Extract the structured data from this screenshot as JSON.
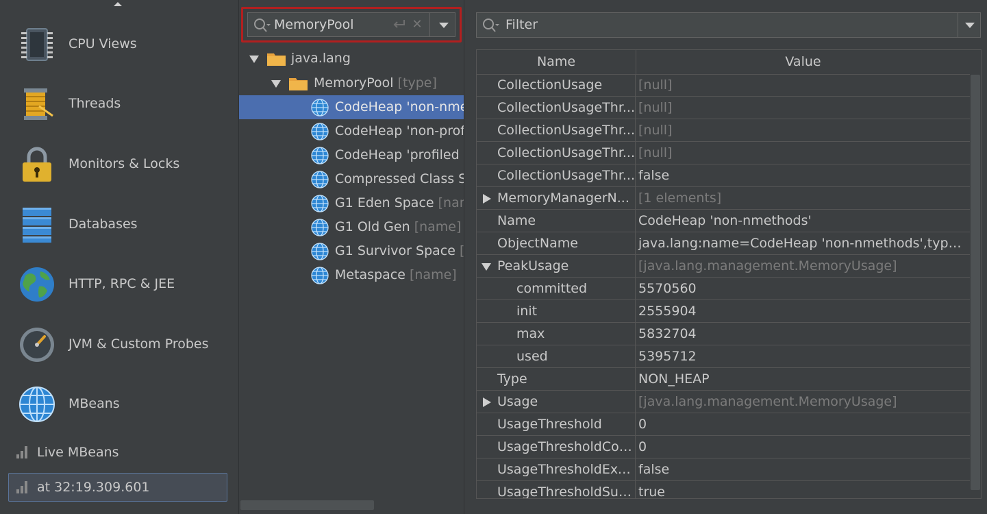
{
  "sidebar": {
    "items": [
      {
        "label": "CPU Views",
        "icon": "cpu-chip-icon"
      },
      {
        "label": "Threads",
        "icon": "threads-spool-icon"
      },
      {
        "label": "Monitors & Locks",
        "icon": "padlock-icon"
      },
      {
        "label": "Databases",
        "icon": "database-icon"
      },
      {
        "label": "HTTP, RPC & JEE",
        "icon": "earth-globe-icon"
      },
      {
        "label": "JVM & Custom Probes",
        "icon": "gauge-probe-icon"
      },
      {
        "label": "MBeans",
        "icon": "mbeans-globe-icon"
      }
    ],
    "sub_items": [
      {
        "label": "Live MBeans",
        "icon": "signal-bars-icon"
      },
      {
        "label": "at 32:19.309.601",
        "icon": "signal-bars-icon"
      }
    ]
  },
  "tree": {
    "search": {
      "value": "MemoryPool",
      "placeholder": ""
    },
    "nodes": [
      {
        "label": "java.lang",
        "suffix": ""
      },
      {
        "label": "MemoryPool",
        "suffix": "[type]"
      },
      {
        "label": "CodeHeap 'non-nme",
        "suffix": ""
      },
      {
        "label": "CodeHeap 'non-prof",
        "suffix": ""
      },
      {
        "label": "CodeHeap 'profiled r",
        "suffix": ""
      },
      {
        "label": "Compressed Class Sp",
        "suffix": ""
      },
      {
        "label": "G1 Eden Space",
        "suffix": "[nam"
      },
      {
        "label": "G1 Old Gen",
        "suffix": "[name]"
      },
      {
        "label": "G1 Survivor Space",
        "suffix": "[n"
      },
      {
        "label": "Metaspace",
        "suffix": "[name]"
      }
    ]
  },
  "filter": {
    "placeholder": "Filter"
  },
  "table": {
    "headers": {
      "name": "Name",
      "value": "Value"
    },
    "rows": [
      {
        "name": "CollectionUsage",
        "value": "[null]"
      },
      {
        "name": "CollectionUsageThr...",
        "value": "[null]"
      },
      {
        "name": "CollectionUsageThr...",
        "value": "[null]"
      },
      {
        "name": "CollectionUsageThr...",
        "value": "[null]"
      },
      {
        "name": "CollectionUsageThr...",
        "value": "false"
      },
      {
        "name": "MemoryManagerN...",
        "value": "[1 elements]"
      },
      {
        "name": "Name",
        "value": "CodeHeap 'non-nmethods'"
      },
      {
        "name": "ObjectName",
        "value": "java.lang:name=CodeHeap 'non-nmethods',type=..."
      },
      {
        "name": "PeakUsage",
        "value": "[java.lang.management.MemoryUsage]"
      },
      {
        "name": "committed",
        "value": "5570560"
      },
      {
        "name": "init",
        "value": "2555904"
      },
      {
        "name": "max",
        "value": "5832704"
      },
      {
        "name": "used",
        "value": "5395712"
      },
      {
        "name": "Type",
        "value": "NON_HEAP"
      },
      {
        "name": "Usage",
        "value": "[java.lang.management.MemoryUsage]"
      },
      {
        "name": "UsageThreshold",
        "value": "0"
      },
      {
        "name": "UsageThresholdCou...",
        "value": "0"
      },
      {
        "name": "UsageThresholdExc...",
        "value": "false"
      },
      {
        "name": "UsageThresholdSup...",
        "value": "true"
      }
    ]
  },
  "colors": {
    "background": "#3c3f41",
    "selection": "#4b6eaf",
    "search_highlight_border": "#b21f1f",
    "folder": "#e8a33d",
    "globe": "#3d8fd6"
  }
}
